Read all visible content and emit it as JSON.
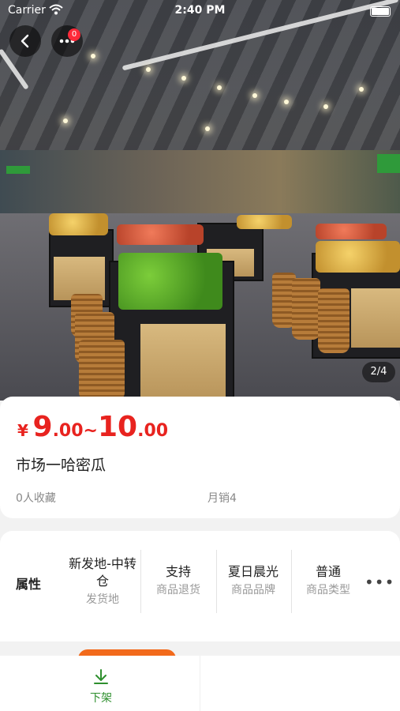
{
  "status_bar": {
    "carrier": "Carrier",
    "time": "2:40 PM"
  },
  "nav": {
    "badge_count": "0"
  },
  "gallery": {
    "counter": "2/4"
  },
  "product": {
    "currency": "¥",
    "price_low_int": "9",
    "price_low_dec": ".00",
    "separator": "~",
    "price_high_int": "10",
    "price_high_dec": ".00",
    "name": "市场一哈密瓜",
    "favorites": "0人收藏",
    "monthly_sales": "月销4"
  },
  "attributes": {
    "label": "属性",
    "items": [
      {
        "value": "新发地-中转仓",
        "caption": "发货地"
      },
      {
        "value": "支持",
        "caption": "商品退货"
      },
      {
        "value": "夏日晨光",
        "caption": "商品品牌"
      },
      {
        "value": "普通",
        "caption": "商品类型"
      }
    ],
    "more": "•••"
  },
  "bottom": {
    "delist_label": "下架"
  },
  "colors": {
    "price": "#e8231f",
    "badge": "#ff2a3a",
    "delist": "#2e8f2e",
    "accent": "#f26a1b"
  },
  "icons": [
    "back-arrow-icon",
    "more-dots-icon",
    "wifi-icon",
    "battery-icon",
    "download-icon"
  ]
}
